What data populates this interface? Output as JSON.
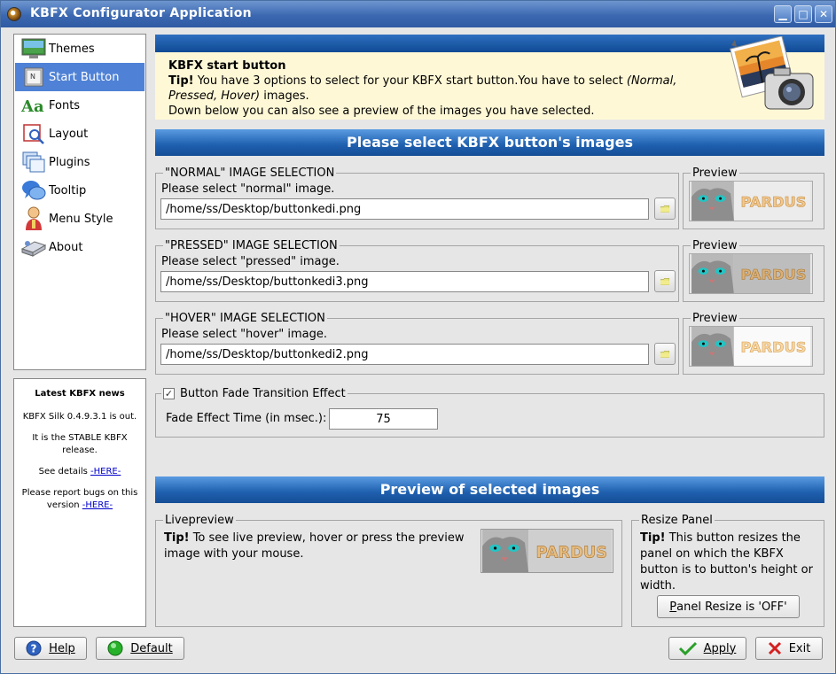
{
  "window": {
    "title": "KBFX Configurator Application",
    "min": "▁",
    "max": "□",
    "close": "✕"
  },
  "sidebar": {
    "items": [
      {
        "label": "Themes",
        "icon": "monitor-icon"
      },
      {
        "label": "Start Button",
        "icon": "start-button-icon"
      },
      {
        "label": "Fonts",
        "icon": "fonts-icon"
      },
      {
        "label": "Layout",
        "icon": "layout-icon"
      },
      {
        "label": "Plugins",
        "icon": "plugins-icon"
      },
      {
        "label": "Tooltip",
        "icon": "tooltip-icon"
      },
      {
        "label": "Menu Style",
        "icon": "menu-style-icon"
      },
      {
        "label": "About",
        "icon": "about-icon"
      }
    ],
    "active_index": 1
  },
  "news": {
    "title": "Latest KBFX news",
    "line1": "KBFX Silk 0.4.9.3.1 is out.",
    "line2": "It is the STABLE KBFX release.",
    "details_prefix": "See details",
    "details_link": "-HERE-",
    "bugs_prefix": "Please report bugs on this version",
    "bugs_link": "-HERE-"
  },
  "header": {
    "title": "KBFX start button",
    "tip_bold": "Tip!",
    "tip_text": " You have 3 options to select for your KBFX start button.You have to select ",
    "tip_italic": "(Normal, Pressed, Hover)",
    "tip_text2": " images.",
    "line2": "Down below you can also see a preview of the images you have selected."
  },
  "section1": {
    "banner": "Please select KBFX button's images"
  },
  "normal": {
    "legend": "\"NORMAL\" IMAGE SELECTION",
    "label": "Please select \"normal\" image.",
    "value": "/home/ss/Desktop/buttonkedi.png"
  },
  "pressed": {
    "legend": "\"PRESSED\" IMAGE SELECTION",
    "label": "Please select \"pressed\" image.",
    "value": "/home/ss/Desktop/buttonkedi3.png"
  },
  "hover": {
    "legend": "\"HOVER\" IMAGE SELECTION",
    "label": "Please select \"hover\" image.",
    "value": "/home/ss/Desktop/buttonkedi2.png"
  },
  "preview_legend": "Preview",
  "logo_text": "PARDUS",
  "fade": {
    "checkbox_label": "Button Fade Transition Effect",
    "checked": true,
    "time_label": "Fade Effect Time (in msec.):",
    "time_value": "75"
  },
  "section2": {
    "banner": "Preview of selected images"
  },
  "livepreview": {
    "legend": "Livepreview",
    "tip_bold": "Tip!",
    "tip_text": " To see live preview, hover or press the preview image with your mouse."
  },
  "resize": {
    "legend": "Resize Panel",
    "tip_bold": "Tip!",
    "tip_text": " This button resizes the panel on which the KBFX button is to button's height or width.",
    "button_hot": "P",
    "button_rest": "anel Resize is 'OFF'"
  },
  "buttons": {
    "help": "Help",
    "default": "Default",
    "apply": "Apply",
    "exit": "Exit"
  },
  "colors": {
    "accent": "#4f82d6",
    "banner": "#1e5fae",
    "header_bg": "#fff8d6"
  }
}
